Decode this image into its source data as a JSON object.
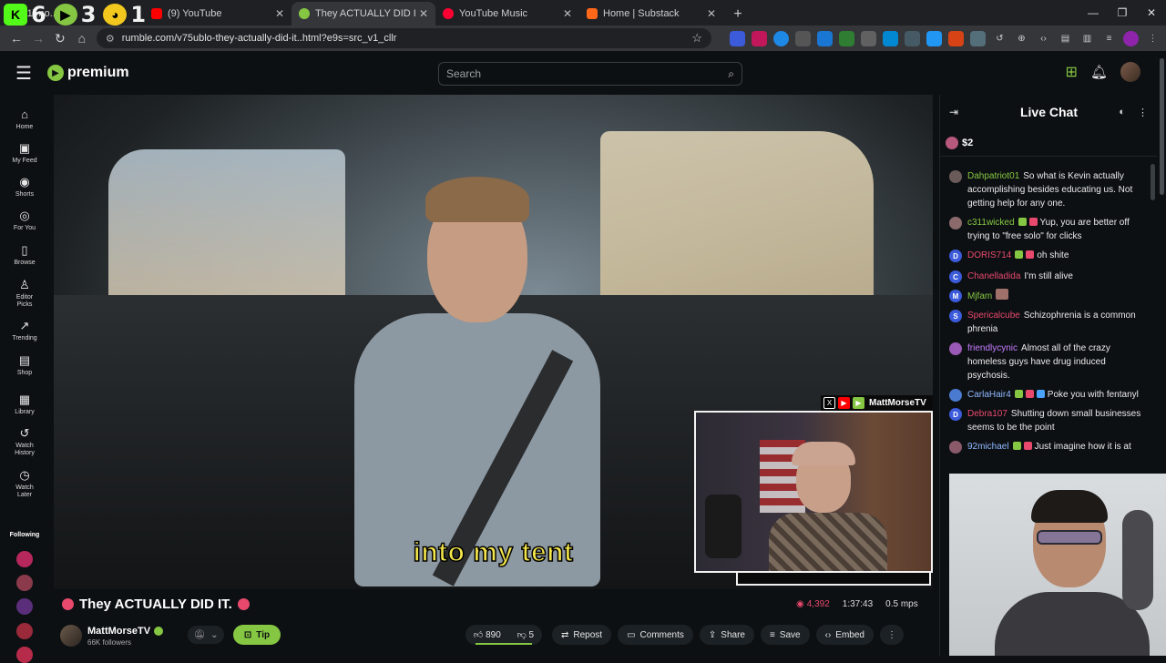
{
  "overlay": {
    "counter_1": "6",
    "counter_2": "3",
    "counter_3": "1"
  },
  "tabs": [
    {
      "title": "(1) no...",
      "color": "#e23b3b"
    },
    {
      "title": "(9) YouTube",
      "color": "#ff0000"
    },
    {
      "title": "They ACTUALLY DID IT.",
      "color": "#85c742"
    },
    {
      "title": "YouTube Music",
      "color": "#ff0033"
    },
    {
      "title": "Home | Substack",
      "color": "#ff6719"
    }
  ],
  "browser": {
    "url": "rumble.com/v75ublo-they-actually-did-it..html?e9s=src_v1_cllr",
    "new_tab": "+"
  },
  "header": {
    "logo": "premium",
    "search_placeholder": "Search"
  },
  "sidebar": {
    "items": [
      {
        "label": "Home",
        "icon": "⌂"
      },
      {
        "label": "My Feed",
        "icon": "▣"
      },
      {
        "label": "Shorts",
        "icon": "◉"
      },
      {
        "label": "For You",
        "icon": "◎"
      },
      {
        "label": "Browse",
        "icon": "▯"
      },
      {
        "label": "Editor Picks",
        "icon": "♙"
      },
      {
        "label": "Trending",
        "icon": "↗"
      },
      {
        "label": "Shop",
        "icon": "▤"
      },
      {
        "label": "Library",
        "icon": "▦"
      },
      {
        "label": "Watch History",
        "icon": "↺"
      },
      {
        "label": "Watch Later",
        "icon": "◷"
      }
    ],
    "following_label": "Following"
  },
  "video": {
    "caption": "into my tent",
    "pip_channel": "MattMorseTV"
  },
  "details": {
    "title": "They ACTUALLY DID IT.",
    "viewers": "4,392",
    "duration": "1:37:43",
    "bitrate": "0.5 mps",
    "channel": "MattMorseTV",
    "followers": "66K followers",
    "tip": "Tip",
    "likes": "890",
    "dislikes": "5",
    "repost": "Repost",
    "comments": "Comments",
    "share": "Share",
    "save": "Save",
    "embed": "Embed"
  },
  "chat": {
    "title": "Live Chat",
    "rant_amount": "$2",
    "messages": [
      {
        "user": "Dahpatriot01",
        "color": "#85c742",
        "text": "So what is Kevin actually accomplishing besides educating us. Not getting help for any one.",
        "avatar": "",
        "avatar_color": "#6a5a5a"
      },
      {
        "user": "c311wicked",
        "color": "#85c742",
        "text": "Yup, you are better off trying to \"free solo\" for clicks",
        "avatar": "",
        "avatar_color": "#8a6a6a"
      },
      {
        "user": "DORIS714",
        "color": "#e8496d",
        "text": "oh shite",
        "avatar": "D",
        "avatar_color": "#3b5bdb"
      },
      {
        "user": "Chanelladida",
        "color": "#e8496d",
        "text": "I'm still alive",
        "avatar": "C",
        "avatar_color": "#3b5bdb"
      },
      {
        "user": "Mjfam",
        "color": "#85c742",
        "text": "",
        "avatar": "M",
        "avatar_color": "#3b5bdb"
      },
      {
        "user": "Spericalcube",
        "color": "#e8496d",
        "text": "Schizophrenia is a common phrenia",
        "avatar": "S",
        "avatar_color": "#3b5bdb"
      },
      {
        "user": "friendlycynic",
        "color": "#c77dff",
        "text": "Almost all of the crazy homeless guys have drug induced psychosis.",
        "avatar": "",
        "avatar_color": "#9b59b6"
      },
      {
        "user": "CarlaHair4",
        "color": "#8fb8ff",
        "text": "Poke you with fentanyl",
        "avatar": "",
        "avatar_color": "#4a7bd0"
      },
      {
        "user": "Debra107",
        "color": "#e8496d",
        "text": "Shutting down small businesses seems to be the point",
        "avatar": "D",
        "avatar_color": "#3b5bdb"
      },
      {
        "user": "92michael",
        "color": "#8fb8ff",
        "text": "Just imagine how it is at",
        "avatar": "",
        "avatar_color": "#8a5a6a"
      }
    ]
  },
  "colors": {
    "brand": "#85c742",
    "live": "#e8496d",
    "caption": "#f4e64a"
  }
}
